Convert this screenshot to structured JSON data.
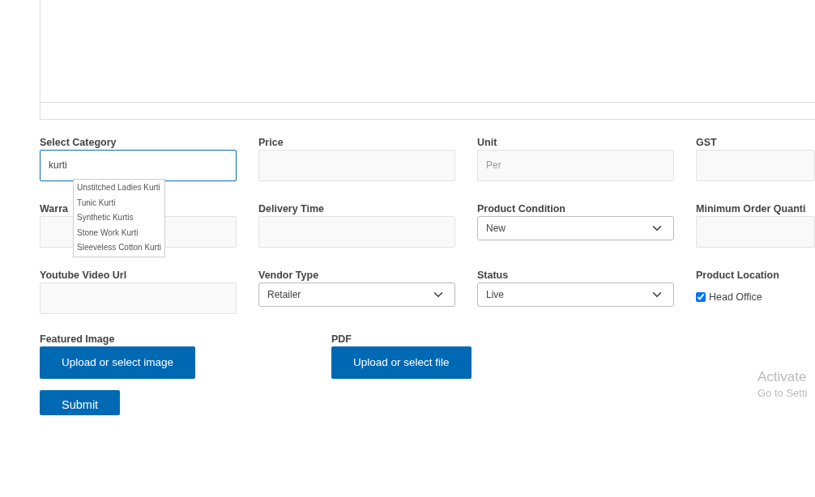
{
  "fields": [
    {
      "label": "Select Category",
      "kind": "input",
      "value": "kurti",
      "focused": true,
      "suggestions": [
        "Unstitched Ladies Kurti",
        "Tunic Kurti",
        "Synthetic Kurtis",
        "Stone Work Kurti",
        "Sleeveless Cotton Kurti"
      ]
    },
    {
      "label": "Price",
      "kind": "input",
      "focused": false
    },
    {
      "label": "Unit",
      "kind": "input",
      "placeholder": "Per",
      "focused": false
    },
    {
      "label": "GST",
      "kind": "input",
      "focused": false
    },
    {
      "label": "Warra",
      "kind": "input",
      "focused": false
    },
    {
      "label": "Delivery Time",
      "kind": "input",
      "focused": false
    },
    {
      "label": "Product Condition",
      "kind": "select",
      "value": "New"
    },
    {
      "label": "Minimum Order Quanti",
      "kind": "input",
      "focused": false
    },
    {
      "label": "Youtube Video Url",
      "kind": "input",
      "focused": false
    },
    {
      "label": "Vendor Type",
      "kind": "select",
      "value": "Retailer"
    },
    {
      "label": "Status",
      "kind": "select",
      "value": "Live"
    },
    {
      "label": "Product Location",
      "kind": "checkbox",
      "text": "Head Office",
      "checked": true
    }
  ],
  "uploads": [
    {
      "label": "Featured Image",
      "button": "Upload or select image"
    },
    {
      "label": "PDF",
      "button": "Upload or select file"
    }
  ],
  "submit": "Submit",
  "activation_notice": {
    "title": "Activate",
    "subtitle": "Go to Setti"
  }
}
